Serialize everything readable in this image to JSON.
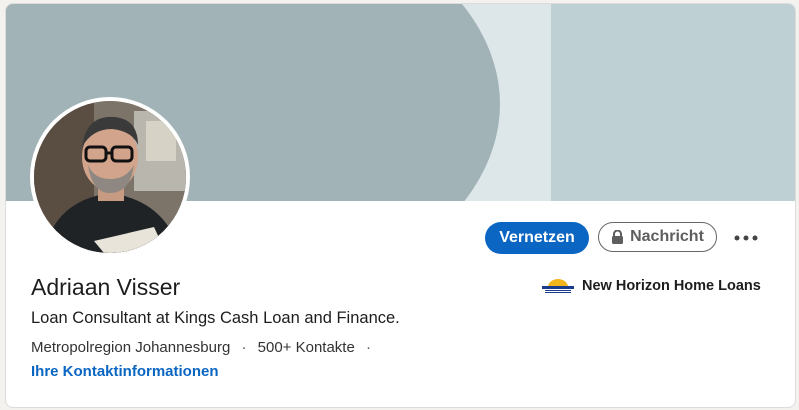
{
  "profile": {
    "name": "Adriaan Visser",
    "headline": "Loan Consultant at Kings Cash Loan and Finance.",
    "location": "Metropolregion Johannesburg",
    "connections": "500+ Kontakte",
    "separator": "·",
    "contact_info_link": "Ihre Kontaktinformationen"
  },
  "actions": {
    "connect_label": "Vernetzen",
    "message_label": "Nachricht",
    "more_icon": "ellipsis-icon"
  },
  "company": {
    "name": "New Horizon Home Loans",
    "logo_text": "NEW HORIZON"
  },
  "colors": {
    "accent": "#0a66c2",
    "banner_dark": "#a1b3b6",
    "banner_light": "#dde7ea",
    "banner_right": "#bfd0d5"
  }
}
